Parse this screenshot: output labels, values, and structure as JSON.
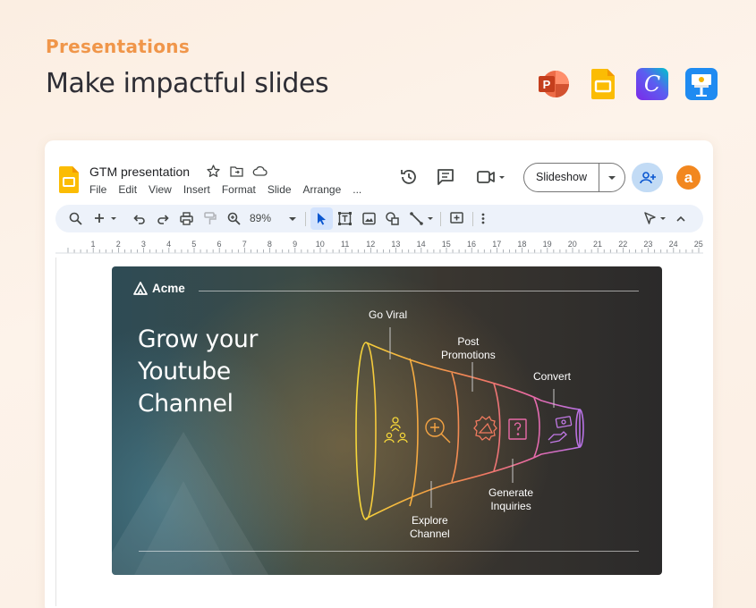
{
  "hero": {
    "eyebrow": "Presentations",
    "headline": "Make impactful slides"
  },
  "apps": [
    {
      "name": "powerpoint-icon",
      "letter": "P"
    },
    {
      "name": "google-slides-icon"
    },
    {
      "name": "canva-icon",
      "letter": "C"
    },
    {
      "name": "keynote-icon"
    }
  ],
  "editor": {
    "doc_title": "GTM presentation",
    "menu": [
      "File",
      "Edit",
      "View",
      "Insert",
      "Format",
      "Slide",
      "Arrange",
      "..."
    ],
    "slideshow_label": "Slideshow",
    "avatar_letter": "a",
    "zoom": "89%",
    "ruler_numbers": [
      "1",
      "2",
      "3",
      "4",
      "5",
      "6",
      "7",
      "8",
      "9",
      "10",
      "11",
      "12",
      "13",
      "14",
      "15",
      "16",
      "17",
      "18",
      "19",
      "20",
      "21",
      "22",
      "23",
      "24",
      "25"
    ]
  },
  "slide": {
    "brand": "Acme",
    "title_lines": [
      "Grow your",
      "Youtube",
      "Channel"
    ],
    "stages": [
      {
        "label": "Go Viral",
        "icon": "people-network-icon"
      },
      {
        "label": "Explore\nChannel",
        "icon": "magnifier-plus-icon"
      },
      {
        "label": "Post\nPromotions",
        "icon": "megaphone-badge-icon"
      },
      {
        "label": "Generate\nInquiries",
        "icon": "question-box-icon"
      },
      {
        "label": "Convert",
        "icon": "hand-money-icon"
      }
    ]
  },
  "colors": {
    "accent_orange": "#f0964a",
    "slides_yellow": "#fbbc04",
    "funnel_yellow": "#f5d63a",
    "funnel_orange": "#f5a443",
    "funnel_red": "#f07a5f",
    "funnel_pink": "#e96aa8",
    "funnel_purple": "#b772e6"
  }
}
